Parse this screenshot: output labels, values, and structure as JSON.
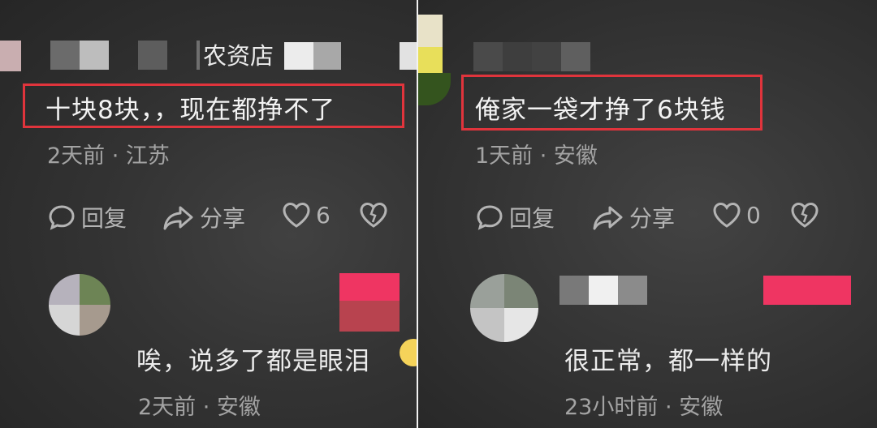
{
  "left": {
    "shop_label": "农资店",
    "comment": "十块8块，，现在都挣不了",
    "meta": "2天前 · 江苏",
    "reply_label": "回复",
    "share_label": "分享",
    "like_count": "6",
    "reply_comment": "唉，说多了都是眼泪",
    "reply_meta": "2天前 · 安徽"
  },
  "right": {
    "comment": "俺家一袋才挣了6块钱",
    "meta": "1天前 · 安徽",
    "reply_label": "回复",
    "share_label": "分享",
    "like_count": "0",
    "reply_comment": "很正常，都一样的",
    "reply_meta": "23小时前 · 安徽"
  },
  "colors": {
    "highlight_border": "#e0343c",
    "badge_pink": "#ef3562"
  },
  "icons": [
    "comment-icon",
    "share-icon",
    "heart-icon",
    "broken-heart-icon",
    "emoji-icon"
  ]
}
